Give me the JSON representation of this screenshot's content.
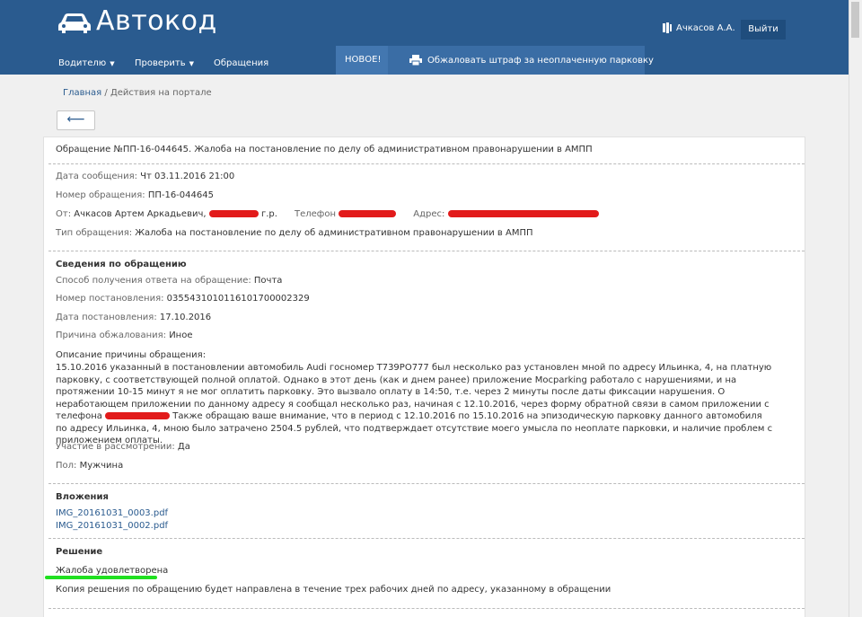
{
  "header": {
    "logo_text": "Автокод",
    "user_name": "Ачкасов А.А.",
    "logout_label": "Выйти"
  },
  "nav": {
    "items": [
      "Водителю",
      "Проверить",
      "Обращения"
    ],
    "new_badge": "НОВОЕ!",
    "promo_label": "Обжаловать штраф за неоплаченную парковку"
  },
  "breadcrumb": {
    "home": "Главная",
    "separator": "/",
    "current": "Действия на портале"
  },
  "request": {
    "title": "Обращение №ПП-16-044645. Жалоба на постановление по делу об административном правонарушении в АМПП",
    "date_label": "Дата сообщения:",
    "date_value": "Чт 03.11.2016 21:00",
    "number_label": "Номер обращения:",
    "number_value": "ПП-16-044645",
    "from_label": "От:",
    "from_value": "Ачкасов Артем Аркадьевич,",
    "from_suffix": "г.р.",
    "phone_label": "Телефон",
    "address_label": "Адрес:",
    "type_label": "Тип обращения:",
    "type_value": "Жалоба на постановление по делу об административном правонарушении в АМПП"
  },
  "details": {
    "heading": "Сведения по обращению",
    "method_label": "Способ получения ответа на обращение:",
    "method_value": "Почта",
    "decree_num_label": "Номер постановления:",
    "decree_num_value": "0355431010116101700002329",
    "decree_date_label": "Дата постановления:",
    "decree_date_value": "17.10.2016",
    "reason_label": "Причина обжалования:",
    "reason_value": "Иное",
    "description_label": "Описание причины обращения:",
    "description_part1": "15.10.2016 указанный в постановлении автомобиль Audi госномер Т739РО777 был несколько раз установлен мной по адресу Ильинка, 4, на платную парковку, с соответствующей полной оплатой. Однако в этот день (как и днем ранее) приложение Мосparking работало с нарушениями, и на протяжении 10-15 минут я не мог оплатить парковку. Это вызвало оплату в 14:50, т.е. через 2 минуты после даты фиксации нарушения. О неработающем приложении по данному адресу я сообщал несколько раз, начиная с 12.10.2016, через форму обратной связи в самом приложении с телефона",
    "description_part2": "Также обращаю ваше внимание, что в период с 12.10.2016 по 15.10.2016 на эпизодическую парковку данного автомобиля по адресу Ильинка, 4, мною было затрачено 2504.5 рублей, что подтверждает отсутствие моего умысла по неоплате парковки, и наличие проблем с приложением оплаты.",
    "participation_label": "Участие в рассмотрении:",
    "participation_value": "Да",
    "gender_label": "Пол:",
    "gender_value": "Мужчина"
  },
  "attachments": {
    "heading": "Вложения",
    "files": [
      "IMG_20161031_0003.pdf",
      "IMG_20161031_0002.pdf"
    ]
  },
  "decision": {
    "heading": "Решение",
    "status": "Жалоба удовлетворена",
    "note": "Копия решения по обращению будет направлена в течение трех рабочих дней по адресу, указанному в обращении"
  },
  "colors": {
    "header_bg": "#2a5b8f",
    "link": "#2a5b8f",
    "redaction": "#e21b1b",
    "highlight": "#20e020"
  }
}
